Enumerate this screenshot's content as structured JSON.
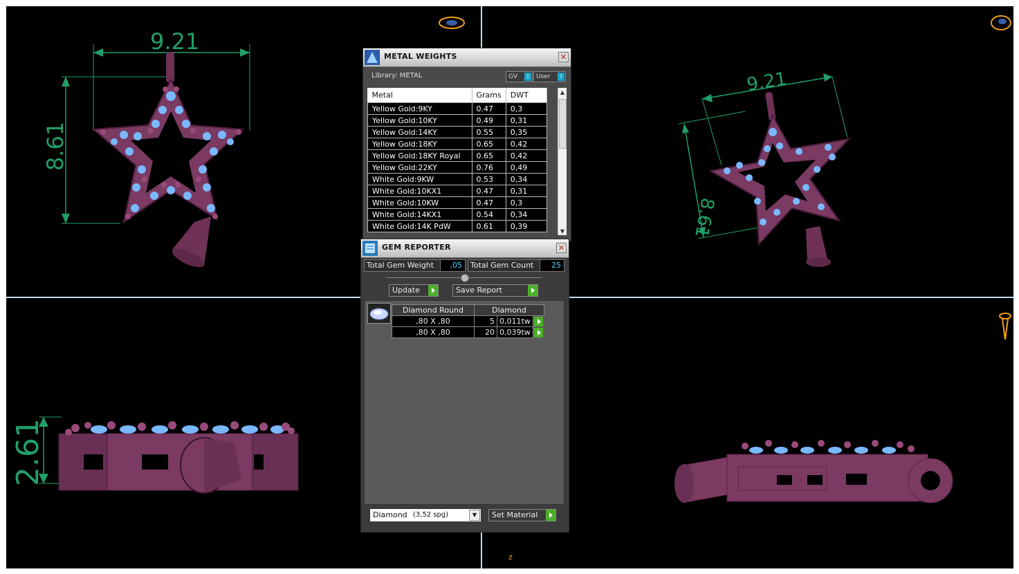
{
  "viewports": {
    "top_left_dims": {
      "width": "9.21",
      "height": "8.61"
    },
    "top_right_dims": {
      "width": "9.21",
      "height": "8.61"
    },
    "bottom_left_dims": {
      "thickness": "2.61"
    },
    "axis_label": "z"
  },
  "metal_weights": {
    "title": "METAL WEIGHTS",
    "library_label": "Library: METAL",
    "toggle_gv": "GV",
    "toggle_user": "User",
    "columns": [
      "Metal",
      "Grams",
      "DWT"
    ],
    "rows": [
      {
        "metal": "Yellow Gold:9KY",
        "grams": "0.47",
        "dwt": "0,3"
      },
      {
        "metal": "Yellow Gold:10KY",
        "grams": "0.49",
        "dwt": "0,31"
      },
      {
        "metal": "Yellow Gold:14KY",
        "grams": "0.55",
        "dwt": "0,35"
      },
      {
        "metal": "Yellow Gold:18KY",
        "grams": "0.65",
        "dwt": "0,42"
      },
      {
        "metal": "Yellow Gold:18KY Royal",
        "grams": "0.65",
        "dwt": "0,42"
      },
      {
        "metal": "Yellow Gold:22KY",
        "grams": "0.76",
        "dwt": "0,49"
      },
      {
        "metal": "White Gold:9KW",
        "grams": "0.53",
        "dwt": "0,34"
      },
      {
        "metal": "White Gold:10KX1",
        "grams": "0.47",
        "dwt": "0,31"
      },
      {
        "metal": "White Gold:10KW",
        "grams": "0.47",
        "dwt": "0,3"
      },
      {
        "metal": "White Gold:14KX1",
        "grams": "0.54",
        "dwt": "0,34"
      },
      {
        "metal": "White Gold:14K PdW",
        "grams": "0.61",
        "dwt": "0,39"
      }
    ]
  },
  "gem_reporter": {
    "title": "GEM REPORTER",
    "total_gem_weight_label": "Total Gem Weight",
    "total_gem_weight_value": ",05",
    "total_gem_count_label": "Total Gem Count",
    "total_gem_count_value": "25",
    "update_label": "Update",
    "save_report_label": "Save Report",
    "gem_header_shape": "Diamond Round",
    "gem_header_material": "Diamond",
    "gem_rows": [
      {
        "size": ",80 X ,80",
        "count": "5",
        "weight": "0,011tw"
      },
      {
        "size": ",80 X ,80",
        "count": "20",
        "weight": "0,039tw"
      }
    ],
    "material_select": "Diamond",
    "material_density": "(3,52 spg)",
    "set_material_label": "Set Material"
  }
}
